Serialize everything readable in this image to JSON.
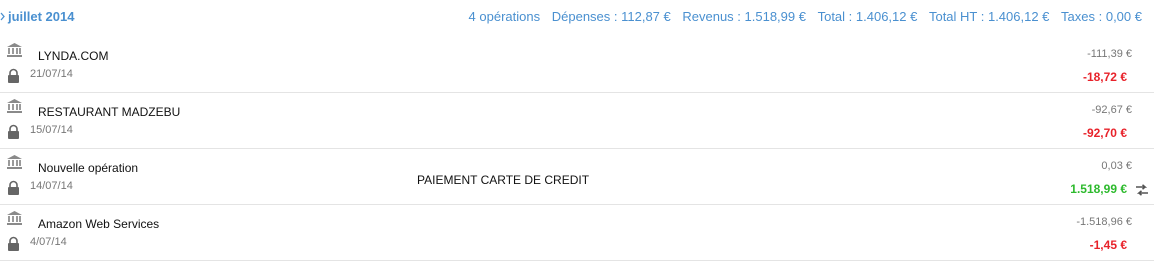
{
  "header": {
    "month_label": "juillet 2014",
    "operations": "4 opérations",
    "depenses": "Dépenses : 112,87 €",
    "revenus": "Revenus : 1.518,99 €",
    "total": "Total : 1.406,12 €",
    "total_ht": "Total HT : 1.406,12 €",
    "taxes": "Taxes : 0,00 €"
  },
  "transactions": [
    {
      "name": "LYNDA.COM",
      "date": "21/07/14",
      "description": "",
      "balance": "-111,39 €",
      "amount": "-18,72 €",
      "amount_type": "negative"
    },
    {
      "name": "RESTAURANT MADZEBU",
      "date": "15/07/14",
      "description": "",
      "balance": "-92,67 €",
      "amount": "-92,70 €",
      "amount_type": "negative"
    },
    {
      "name": "Nouvelle opération",
      "date": "14/07/14",
      "description": "PAIEMENT CARTE DE CREDIT",
      "balance": "0,03 €",
      "amount": "1.518,99 €",
      "amount_type": "positive"
    },
    {
      "name": "Amazon Web Services",
      "date": "4/07/14",
      "description": "",
      "balance": "-1.518,96 €",
      "amount": "-1,45 €",
      "amount_type": "negative"
    }
  ],
  "colors": {
    "accent": "#4a90d0",
    "negative": "#e8222a",
    "positive": "#2dba2d"
  },
  "icons": {
    "row_type": "bank-icon",
    "row_status": "lock-icon",
    "transfer": "transfer-arrows-icon",
    "month_toggle": "chevron-icon"
  }
}
